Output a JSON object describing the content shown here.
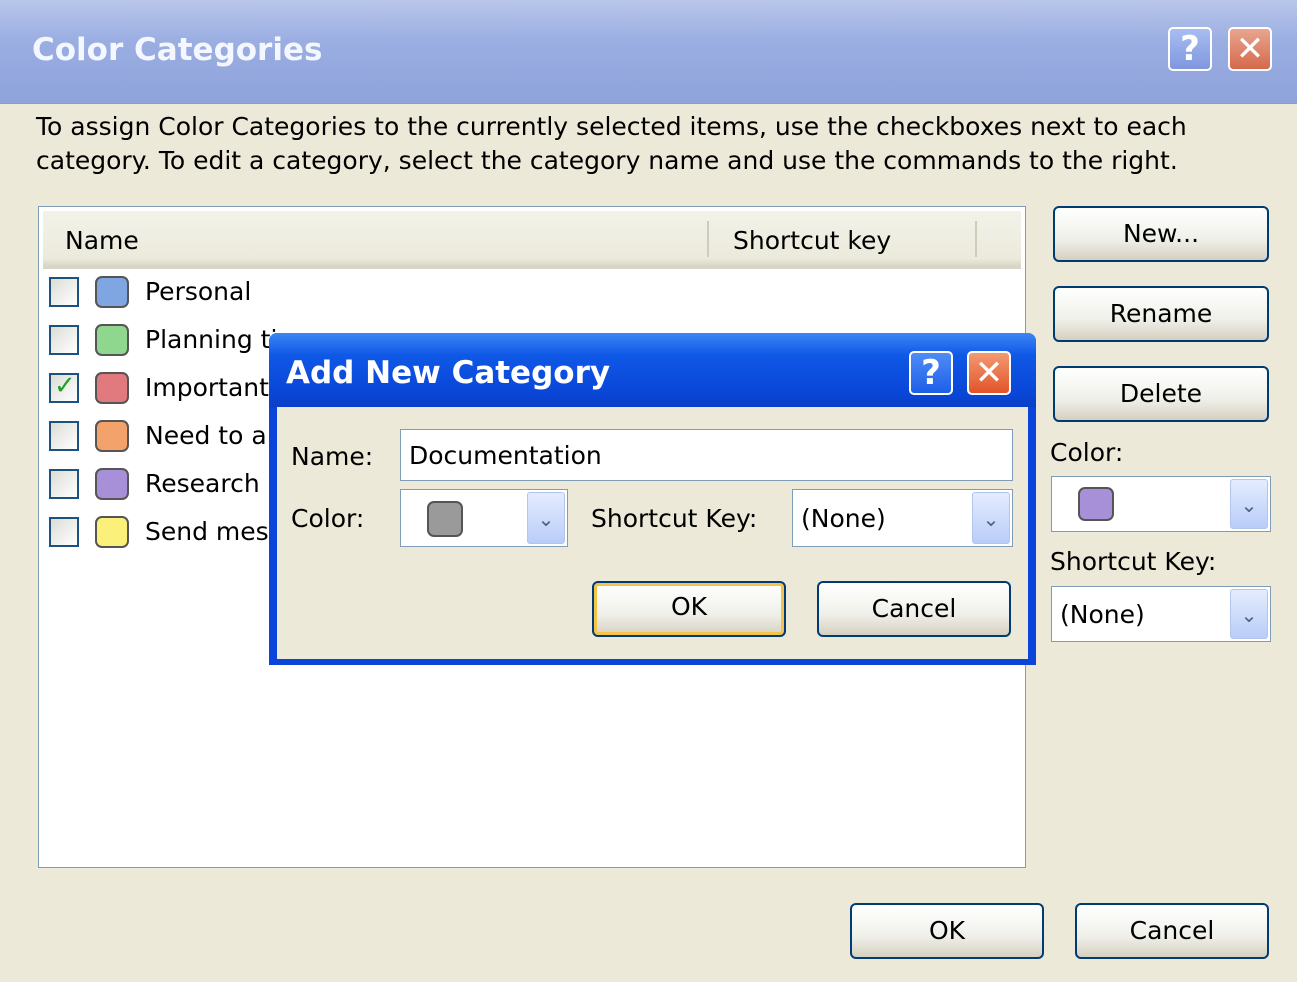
{
  "outer_dialog": {
    "title": "Color Categories",
    "instructions": "To assign Color Categories to the currently selected items, use the checkboxes next to each category.  To edit a category, select the category name and use the commands to the right.",
    "columns": {
      "name": "Name",
      "shortcut": "Shortcut key"
    },
    "categories": [
      {
        "label": "Personal",
        "checked": false,
        "color": "#7fa6e0"
      },
      {
        "label": "Planning time",
        "checked": false,
        "color": "#8fd68f"
      },
      {
        "label": "Important",
        "checked": true,
        "color": "#e07a7f"
      },
      {
        "label": "Need to a",
        "checked": false,
        "color": "#f4a26b"
      },
      {
        "label": "Research",
        "checked": false,
        "color": "#a890d8"
      },
      {
        "label": "Send mes",
        "checked": false,
        "color": "#fbf07a"
      }
    ],
    "buttons": {
      "new": "New...",
      "rename": "Rename",
      "delete": "Delete",
      "ok": "OK",
      "cancel": "Cancel"
    },
    "color_label": "Color:",
    "color_value": "#a890d8",
    "shortcut_label": "Shortcut Key:",
    "shortcut_value": "(None)"
  },
  "inner_dialog": {
    "title": "Add New Category",
    "name_label": "Name:",
    "name_value": "Documentation",
    "color_label": "Color:",
    "color_value": "#9a9a9a",
    "shortcut_label": "Shortcut Key:",
    "shortcut_value": "(None)",
    "ok": "OK",
    "cancel": "Cancel"
  },
  "icons": {
    "help": "?",
    "close": "✕",
    "dropdown": "⌄"
  }
}
